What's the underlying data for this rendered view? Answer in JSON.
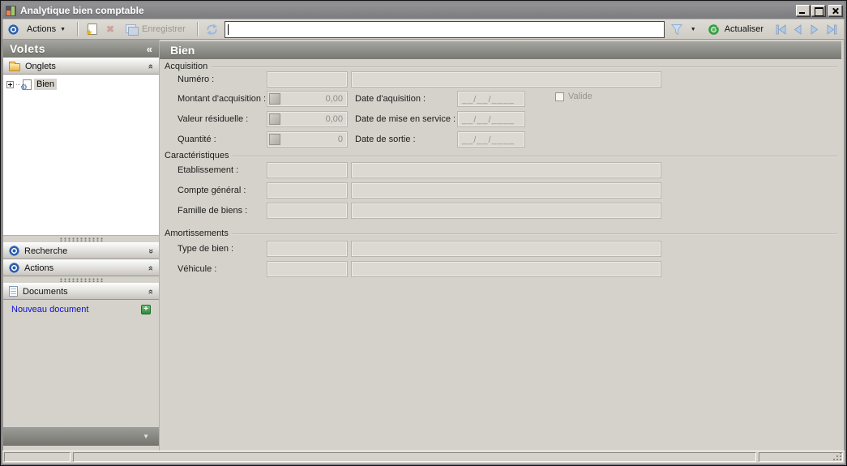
{
  "window": {
    "title": "Analytique bien comptable"
  },
  "toolbar": {
    "actions_label": "Actions",
    "save_label": "Enregistrer",
    "refresh_label": "Actualiser",
    "command_value": ""
  },
  "sidebar": {
    "title": "Volets",
    "onglets_label": "Onglets",
    "tree_item_label": "Bien",
    "recherche_label": "Recherche",
    "actions_label": "Actions",
    "documents_label": "Documents",
    "new_document_label": "Nouveau document"
  },
  "main": {
    "title": "Bien",
    "acquisition": {
      "title": "Acquisition",
      "numero_label": "Numéro :",
      "montant_label": "Montant d'acquisition :",
      "montant_value": "0,00",
      "date_aquisition_label": "Date d'aquisition :",
      "valide_label": "Valide",
      "valeur_label": "Valeur résiduelle :",
      "valeur_value": "0,00",
      "date_mise_en_service_label": "Date de mise en service :",
      "quantite_label": "Quantité :",
      "quantite_value": "0",
      "date_sortie_label": "Date de sortie :",
      "date_mask": "__/__/____"
    },
    "caracteristiques": {
      "title": "Caractéristiques",
      "etablissement_label": "Etablissement :",
      "compte_general_label": "Compte général :",
      "famille_biens_label": "Famille de biens :"
    },
    "amortissements": {
      "title": "Amortissements",
      "type_bien_label": "Type de bien :",
      "vehicule_label": "Véhicule :"
    }
  },
  "icons": {
    "collapse_left": "«",
    "chevron": "»",
    "dropdown": "▼"
  },
  "colors": {
    "titlebar_gray": "#87878a",
    "panel_header_top": "#a6a6a2",
    "panel_header_bottom": "#797973",
    "window_bg": "#d5d2cb",
    "link_blue": "#0f0fd0",
    "accent_blue": "#2d5fae",
    "accent_green": "#2e9e3e",
    "nav_blue": "#b3c9e4"
  },
  "statusbar": {
    "left": "",
    "middle": "",
    "right": ""
  }
}
